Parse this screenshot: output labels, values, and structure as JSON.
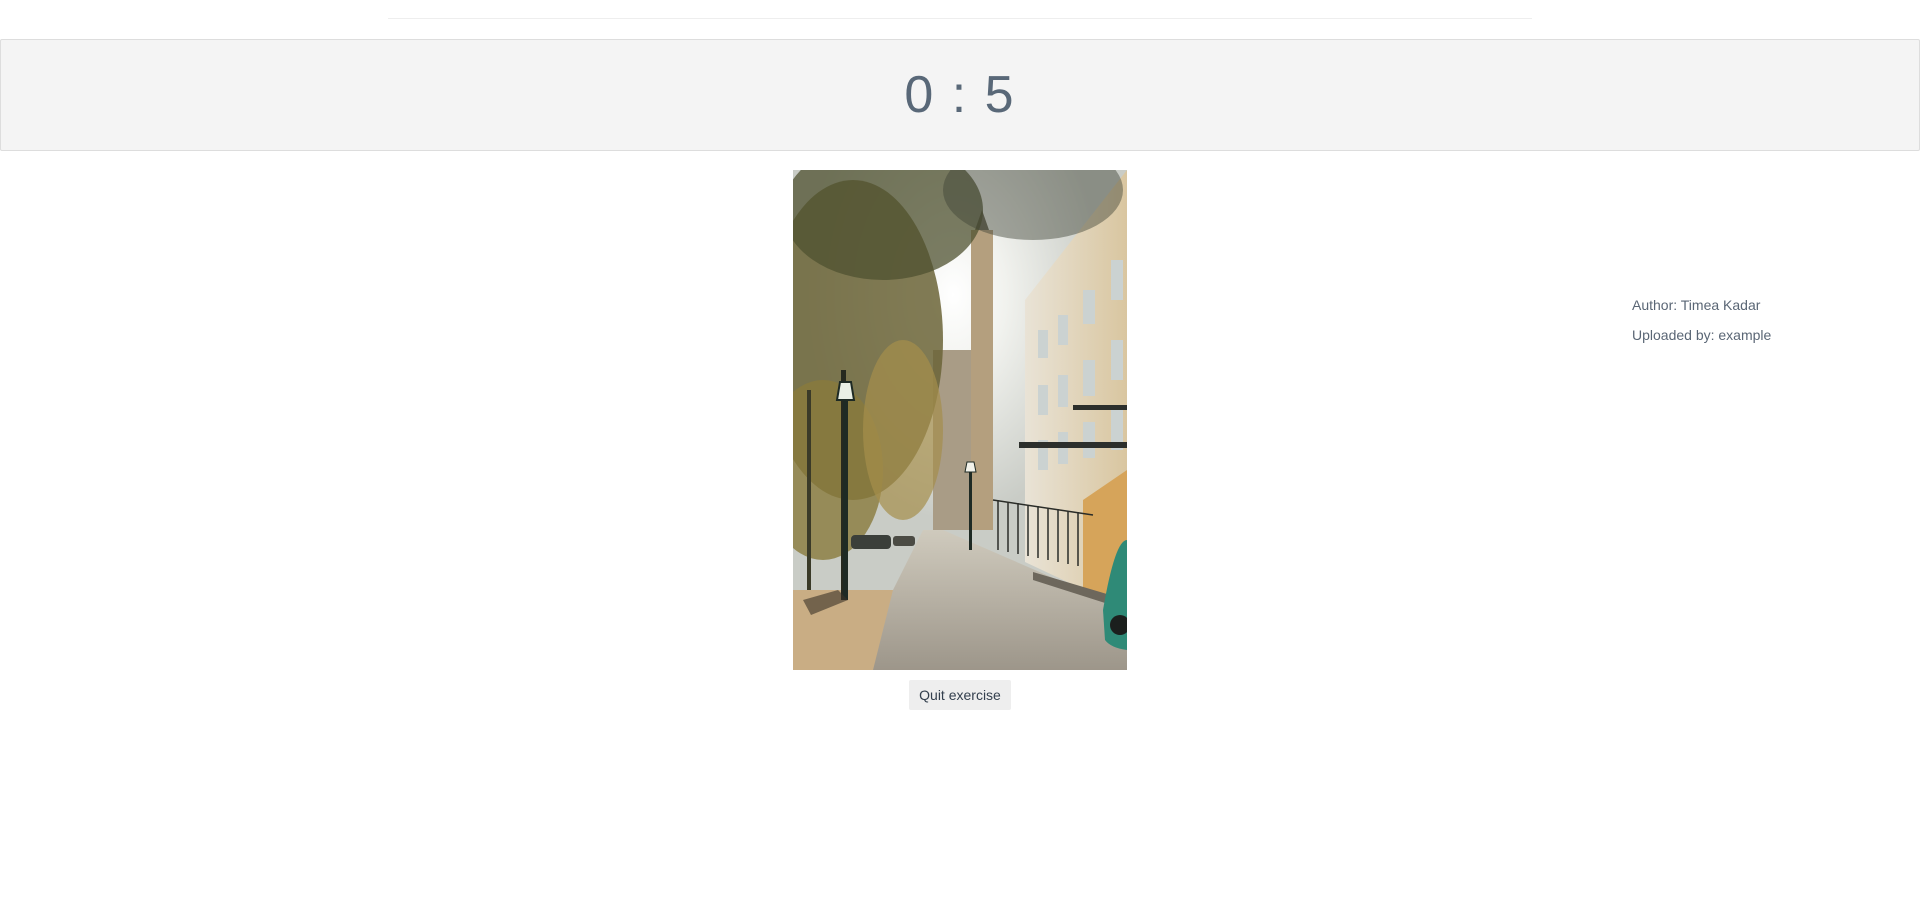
{
  "timer": {
    "display": "0 : 5"
  },
  "photo": {
    "subject": "street-with-trees-and-buildings"
  },
  "actions": {
    "quit_label": "Quit exercise"
  },
  "info": {
    "author": "Author: Timea Kadar",
    "uploaded_by": "Uploaded by: example"
  }
}
